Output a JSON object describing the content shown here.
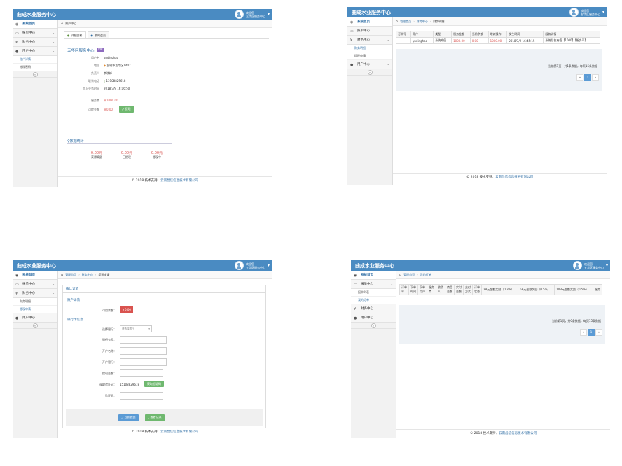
{
  "app_title": "曲成水业服务中心",
  "user": {
    "greeting": "欢迎您",
    "name": "五华区服务中心"
  },
  "common": {
    "sidebar_home": "系统首页",
    "menu_orders": "报单中心",
    "menu_finance": "财务中心",
    "menu_account": "用户中心",
    "sub_account_detail": "账户详情",
    "sub_change_password": "修改密码",
    "sub_finance_detail": "财务明细",
    "sub_withdraw": "提现申请",
    "sub_order_list": "报单列表",
    "sub_my_orders": "我的订单",
    "collapse": "«",
    "footer_text": "© 2018 技术支持：",
    "footer_link": "云南昌信信息技术有限公司"
  },
  "screen1": {
    "crumb": "账户中心",
    "tabs": [
      "详细资料",
      "我的会员"
    ],
    "shop_name": "五华区服务中心",
    "vip": "VIP",
    "fields": [
      {
        "k": "用户名",
        "v": "yndinghao"
      },
      {
        "k": "地址",
        "v": "昆明市五华区1402"
      },
      {
        "k": "负责人",
        "v": "李晓峰"
      },
      {
        "k": "联系电话",
        "v": "15108829618"
      },
      {
        "k": "加入业务时间",
        "v": "2018/3/9 16:16:50"
      }
    ],
    "deposit_label": "服务费",
    "deposit_value": "￥1000.00",
    "withdrawable_label": "可提金额",
    "withdrawable_value": "￥0.00",
    "withdraw_btn": "提现",
    "stats_title": "数据统计",
    "stats": [
      {
        "n": "0.00元",
        "label": "获得奖励"
      },
      {
        "n": "0.00元",
        "label": "已提现"
      },
      {
        "n": "0.00元",
        "label": "提现中"
      }
    ]
  },
  "screen2": {
    "crumbs": [
      "管理首页",
      "财务中心",
      "财务明细"
    ],
    "headers": [
      "订单号",
      "用户",
      "类型",
      "服务金额",
      "当前余额",
      "增减操作",
      "发生时间",
      "服务详情"
    ],
    "row": [
      "",
      "yndinghao",
      "系统充值",
      "1000.00",
      "0.00",
      "1000.00",
      "2018/3/9 16:45:15",
      "系统后台充值【1000】【服务币】"
    ],
    "pager_info": "当前第1页，共1条数据，每页15条数据",
    "pager": [
      "«",
      "1",
      "»"
    ]
  },
  "screen3": {
    "crumbs": [
      "管理首页",
      "财务中心",
      "提现申请"
    ],
    "form_title": "确认订单",
    "section_account": "账户详情",
    "available_label": "可用余额：",
    "available_value": "￥0.00",
    "section_bank": "银行卡信息",
    "bank_select_label": "选择银行：",
    "bank_select_value": "请选择银行",
    "card_no_label": "银行卡号：",
    "holder_label": "开户名称：",
    "branch_label": "开户银行：",
    "amount_label": "提现金额：",
    "code_get_label": "获取验证码：",
    "phone": "15108829618",
    "code_btn": "获取验证码",
    "code_label": "验证码：",
    "confirm_btn": "立即提交",
    "query_btn": "查看记录"
  },
  "screen4": {
    "crumbs": [
      "管理首页",
      "我的订单"
    ],
    "headers": [
      "订单号",
      "下单时间",
      "下单用户",
      "服务商",
      "收货人",
      "商品金额",
      "实付金额",
      "支付方式",
      "订单状态",
      "2B元金额奖励（0.3%）",
      "5B元金额奖励（0.5%）",
      "10B元金额奖励（0.5%）",
      "服务"
    ],
    "pager_info": "当前第1页，共0条数据，每页15条数据",
    "pager": [
      "«",
      "1",
      "»"
    ]
  }
}
